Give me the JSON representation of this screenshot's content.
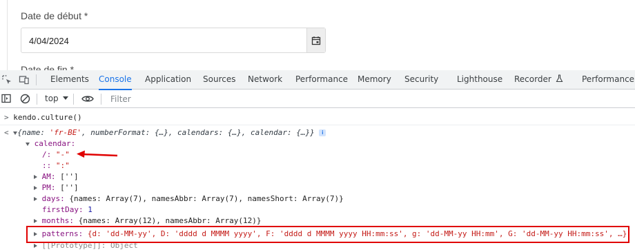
{
  "form": {
    "start_label": "Date de début *",
    "start_value": "4/04/2024",
    "next_label": "Date de fin *"
  },
  "devtools": {
    "tabs": [
      {
        "label": "Elements"
      },
      {
        "label": "Console"
      },
      {
        "label": "Application"
      },
      {
        "label": "Sources"
      },
      {
        "label": "Network"
      },
      {
        "label": "Performance"
      },
      {
        "label": "Memory"
      },
      {
        "label": "Security"
      },
      {
        "label": "Lighthouse"
      },
      {
        "label": "Recorder"
      },
      {
        "label": "Performance in"
      }
    ],
    "active_tab": "Console",
    "context": "top",
    "filter_placeholder": "Filter"
  },
  "console": {
    "command": "kendo.culture()",
    "result_summary_open": "{",
    "result_name_key": "name",
    "result_name_val": "'fr-BE'",
    "result_rest": ", numberFormat: {…}, calendars: {…}, calendar: {…}}",
    "calendar_key": "calendar",
    "sep_slash_key": "/",
    "sep_slash_val": "\"-\"",
    "sep_colon_key": "::",
    "sep_colon_val": "\":\"",
    "am_key": "AM",
    "am_val": "['']",
    "pm_key": "PM",
    "pm_val": "['']",
    "days_key": "days",
    "days_val": "{names: Array(7), namesAbbr: Array(7), namesShort: Array(7)}",
    "firstday_key": "firstDay",
    "firstday_val": "1",
    "months_key": "months",
    "months_val": "{names: Array(12), namesAbbr: Array(12)}",
    "patterns_key": "patterns",
    "patterns_val": "{d: 'dd-MM-yy', D: 'dddd d MMMM yyyy', F: 'dddd d MMMM yyyy HH:mm:ss', g: 'dd-MM-yy HH:mm', G: 'dd-MM-yy HH:mm:ss', …}",
    "prototype_key": "[[Prototype]]",
    "prototype_val": "Object"
  },
  "colors": {
    "accent": "#1a73e8",
    "annotation_red": "#e00000"
  }
}
